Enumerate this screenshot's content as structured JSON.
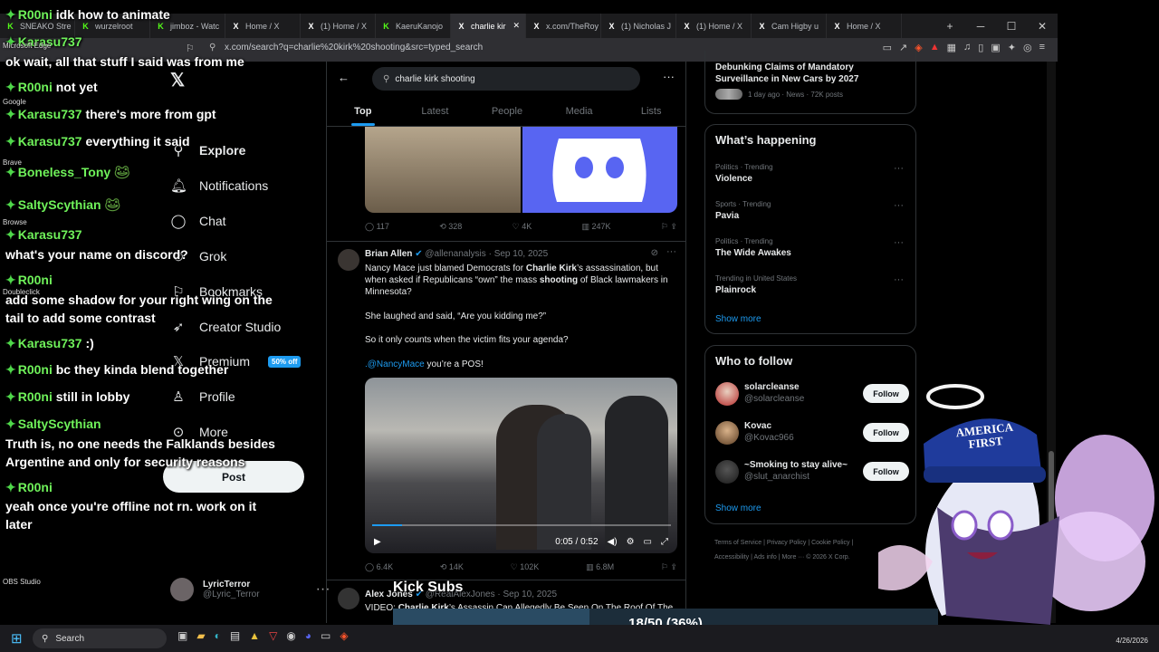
{
  "browser": {
    "tabs": [
      {
        "icon": "K",
        "label": "SNEAKO Stre"
      },
      {
        "icon": "K",
        "label": "wurzelroot"
      },
      {
        "icon": "K",
        "label": "jimboz - Watc"
      },
      {
        "icon": "X",
        "label": "Home / X"
      },
      {
        "icon": "X",
        "label": "(1) Home / X"
      },
      {
        "icon": "K",
        "label": "KaeruKanojo"
      },
      {
        "icon": "X",
        "label": "charlie kir"
      },
      {
        "icon": "X",
        "label": "x.com/TheRoy"
      },
      {
        "icon": "X",
        "label": "(1) Nicholas J"
      },
      {
        "icon": "X",
        "label": "(1) Home / X"
      },
      {
        "icon": "X",
        "label": "Cam Higby u"
      },
      {
        "icon": "X",
        "label": "Home / X"
      }
    ],
    "active_tab": 6,
    "url": "x.com/search?q=charlie%20kirk%20shooting&src=typed_search"
  },
  "x_nav": {
    "items": [
      "Explore",
      "Notifications",
      "Chat",
      "Grok",
      "Bookmarks",
      "Creator Studio",
      "Premium",
      "Profile",
      "More"
    ],
    "premium_badge": "50% off",
    "post_button": "Post",
    "account_name": "LyricTerror",
    "account_handle": "@Lyric_Terror"
  },
  "search": {
    "query": "charlie kirk shooting",
    "tabs": [
      "Top",
      "Latest",
      "People",
      "Media",
      "Lists"
    ],
    "active_tab": "Top"
  },
  "tweet1_stats": {
    "replies": "117",
    "reposts": "328",
    "likes": "4K",
    "views": "247K"
  },
  "tweet2": {
    "name": "Brian Allen",
    "handle": "@allenanalysis",
    "date": "Sep 10, 2025",
    "text_p1_a": "Nancy Mace just blamed Democrats for ",
    "text_p1_b": "Charlie Kirk",
    "text_p1_c": "’s assassination, but when asked if Republicans “own” the mass ",
    "text_p1_d": "shooting",
    "text_p1_e": " of Black lawmakers in Minnesota?",
    "text_p2": "She laughed and said, “Are you kidding me?”",
    "text_p3": "So it only counts when the victim fits your agenda?",
    "text_p4_link": ".@NancyMace",
    "text_p4_rest": " you’re a POS!",
    "video_time": "0:05 / 0:52",
    "video_progress": 0.1,
    "stats": {
      "replies": "6.4K",
      "reposts": "14K",
      "likes": "102K",
      "views": "6.8M"
    }
  },
  "tweet3": {
    "name": "Alex Jones",
    "handle": "@RealAlexJones",
    "date": "Sep 10, 2025",
    "text_a": "VIDEO: ",
    "text_b": "Charlie Kirk",
    "text_c": "’s Assassin Can Allegedly Be Seen On The Roof Of The"
  },
  "right": {
    "top_news_title": "Debunking Claims of Mandatory Surveillance in New Cars by 2027",
    "top_news_meta": "1 day ago · News · 72K posts",
    "happening_title": "What’s happening",
    "trends": [
      {
        "category": "Politics · Trending",
        "name": "Violence"
      },
      {
        "category": "Sports · Trending",
        "name": "Pavia"
      },
      {
        "category": "Politics · Trending",
        "name": "The Wide Awakes"
      },
      {
        "category": "Trending in United States",
        "name": "Plainrock"
      }
    ],
    "show_more": "Show more",
    "wtf_title": "Who to follow",
    "follow_label": "Follow",
    "who_to_follow": [
      {
        "name": "solarcleanse",
        "handle": "@solarcleanse"
      },
      {
        "name": "Kovac",
        "handle": "@Kovac966"
      },
      {
        "name": "~Smoking to stay alive~",
        "handle": "@slut_anarchist"
      }
    ],
    "show_more_2": "Show more",
    "footer_1": "Terms of Service  |  Privacy Policy  |  Cookie Policy  |",
    "footer_2": "Accessibility  |  Ads info  |  More ···  © 2026 X Corp."
  },
  "chat": [
    {
      "user": "R00ni",
      "msg": "idk how to animate",
      "color": "green"
    },
    {
      "user": "Karasu737",
      "msg": "",
      "color": "green"
    },
    {
      "user": "",
      "msg": "ok wait, all that stuff I said was from me",
      "color": "green"
    },
    {
      "user": "R00ni",
      "msg": "not yet",
      "color": "green"
    },
    {
      "user": "Karasu737",
      "msg": "there's more from gpt",
      "color": "green"
    },
    {
      "user": "Karasu737",
      "msg": "everything it said",
      "color": "green"
    },
    {
      "user": "Boneless_Tony",
      "msg": "",
      "color": "green"
    },
    {
      "user": "SaltyScythian",
      "msg": "",
      "color": "green"
    },
    {
      "user": "Karasu737",
      "msg": "",
      "color": "green"
    },
    {
      "user": "",
      "msg": "what's your name on discord?",
      "color": "green"
    },
    {
      "user": "R00ni",
      "msg": "",
      "color": "green"
    },
    {
      "user": "",
      "msg": "add some shadow for your right wing on the",
      "color": "green"
    },
    {
      "user": "",
      "msg": "tail to add some contrast",
      "color": "green"
    },
    {
      "user": "Karasu737",
      "msg": ":)",
      "color": "green"
    },
    {
      "user": "R00ni",
      "msg": "bc they kinda blend together",
      "color": "green"
    },
    {
      "user": "R00ni",
      "msg": "still in lobby",
      "color": "green"
    },
    {
      "user": "SaltyScythian",
      "msg": "",
      "color": "green"
    },
    {
      "user": "",
      "msg": "Truth is, no one needs the Falklands besides",
      "color": "green"
    },
    {
      "user": "",
      "msg": "Argentine and only for security reasons",
      "color": "green"
    },
    {
      "user": "R00ni",
      "msg": "",
      "color": "green"
    },
    {
      "user": "",
      "msg": "yeah once you're offline not rn. work on it",
      "color": "green"
    },
    {
      "user": "",
      "msg": "later",
      "color": "green"
    }
  ],
  "desktop_labels": [
    "Microsoft Edge",
    "Google",
    "Brave",
    "Browse",
    "Doubleclick",
    "OBS Studio"
  ],
  "stream": {
    "kick_subs_label": "Kick Subs",
    "sub_goal_text": "18/50 (36%)",
    "sub_goal_fraction": 0.36,
    "vtuber_hat_text": "AMERICA FIRST"
  },
  "taskbar": {
    "search_placeholder": "Search",
    "date": "4/26/2026"
  },
  "colors": {
    "accent": "#1d9bf0",
    "chat_user": "#6ff25a",
    "discord": "#5865f2"
  }
}
